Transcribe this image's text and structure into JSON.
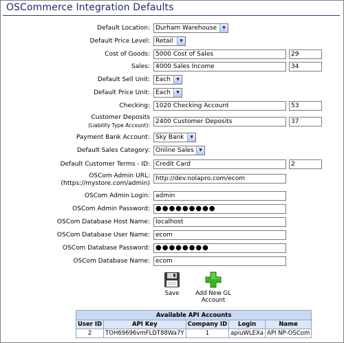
{
  "page": {
    "title": "OSCommerce Integration Defaults"
  },
  "form": {
    "default_location": {
      "label": "Default Location:",
      "value": "Durham Warehouse"
    },
    "default_price_level": {
      "label": "Default Price Level:",
      "value": "Retail"
    },
    "cost_of_goods": {
      "label": "Cost of Goods:",
      "value": "5000 Cost of Sales",
      "code": "29"
    },
    "sales": {
      "label": "Sales:",
      "value": "4000 Sales Income",
      "code": "34"
    },
    "default_sell_unit": {
      "label": "Default Sell Unit:",
      "value": "Each"
    },
    "default_price_unit": {
      "label": "Default Price Unit:",
      "value": "Each"
    },
    "checking": {
      "label": "Checking:",
      "value": "1020 Checking Account",
      "code": "53"
    },
    "customer_deposits": {
      "label": "Customer Deposits",
      "sublabel": "(Liability Type Account):",
      "value": "2400 Customer Deposits",
      "code": "37"
    },
    "payment_bank_account": {
      "label": "Payment Bank Account:",
      "value": "Sky Bank"
    },
    "default_sales_category": {
      "label": "Default Sales Category:",
      "value": "Online Sales"
    },
    "default_customer_terms": {
      "label": "Default Customer Terms - ID:",
      "value": "Credit Card",
      "code": "2"
    },
    "admin_url": {
      "label": "OSCom Admin URL:",
      "sublabel": "(https://mystore.com/admin)",
      "value": "http://dev.nolapro.com/ecom"
    },
    "admin_login": {
      "label": "OSCom Admin Login:",
      "value": "admin"
    },
    "admin_password": {
      "label": "OSCom Admin Password:",
      "value": "●●●●●●●●●"
    },
    "db_host": {
      "label": "OSCom Database Host Name:",
      "value": "localhost"
    },
    "db_user": {
      "label": "OSCom Database User Name:",
      "value": "ecom"
    },
    "db_password": {
      "label": "OSCom Database Password:",
      "value": "●●●●●●●●"
    },
    "db_name": {
      "label": "OSCom Database Name:",
      "value": "ecom"
    }
  },
  "actions": {
    "save_label": "Save",
    "add_gl_label_1": "Add New GL",
    "add_gl_label_2": "Account"
  },
  "api_table": {
    "caption": "Available API Accounts",
    "headers": [
      "User ID",
      "API Key",
      "Company ID",
      "Login",
      "Name"
    ],
    "rows": [
      [
        "2",
        "TOH69696vmFLDT88Wa7Y",
        "1",
        "apiuWLEXa",
        "API NP-OSCom"
      ]
    ]
  },
  "colors": {
    "title": "#1a2d6b",
    "table_header": "#c9d9f1",
    "add_icon": "#3cb521"
  }
}
